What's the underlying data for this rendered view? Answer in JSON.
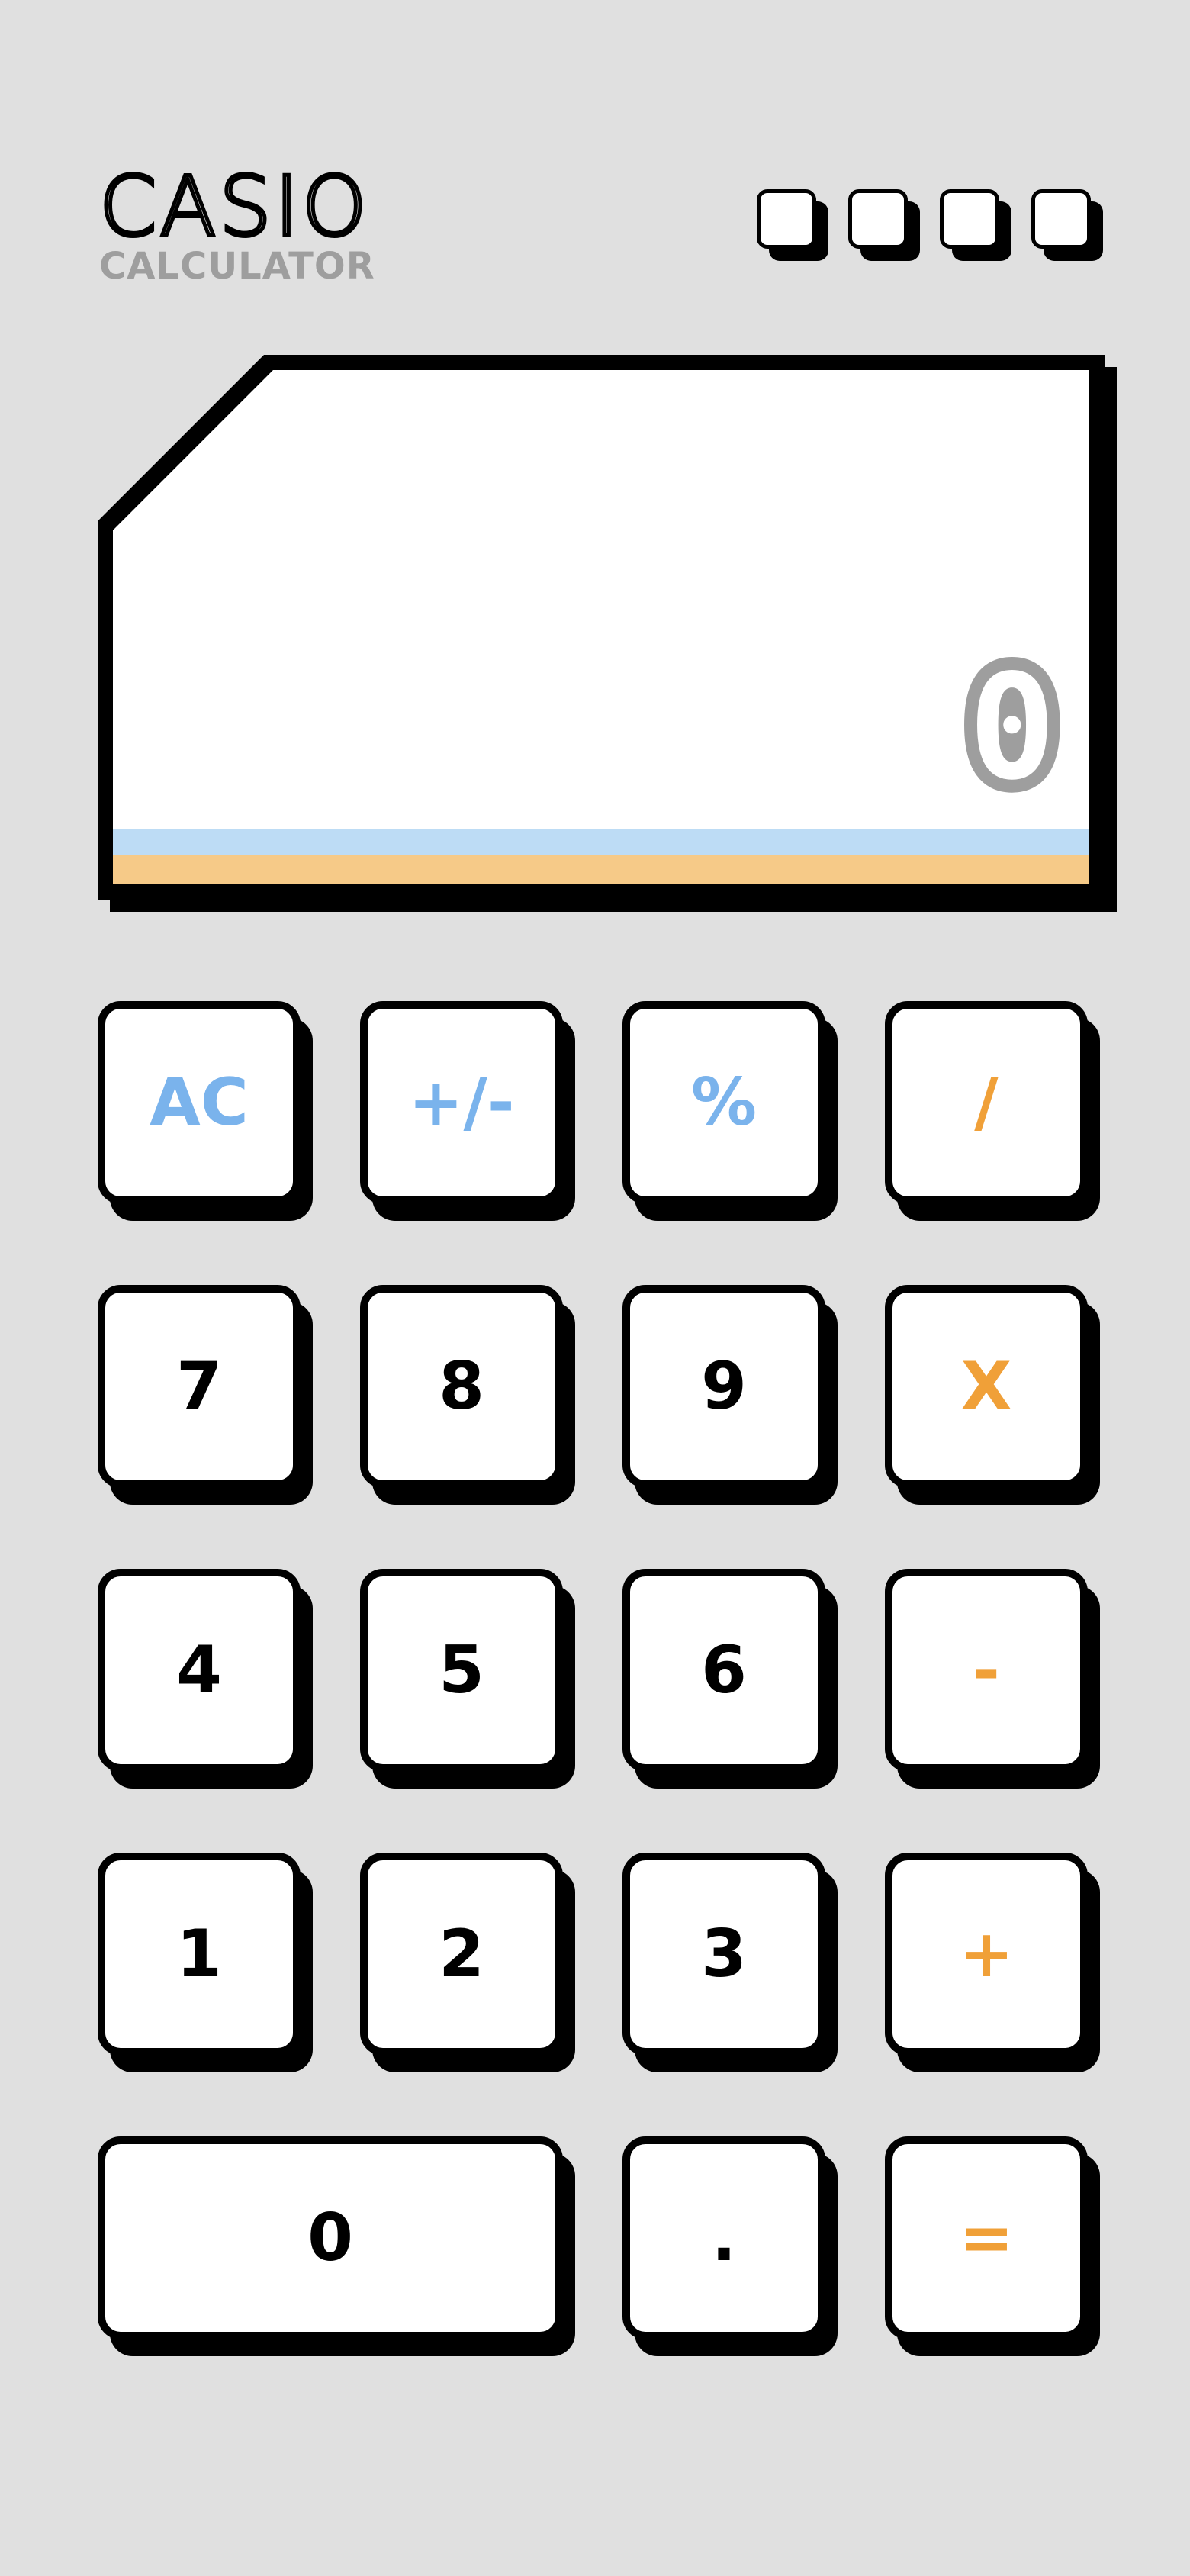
{
  "header": {
    "brand": "CASIO",
    "subtitle": "CALCULATOR"
  },
  "display": {
    "value": "0"
  },
  "colors": {
    "background": "#e0e0e0",
    "function_key_text": "#7ab3ec",
    "operator_key_text": "#f0a038",
    "display_text": "#9e9e9e",
    "stripe_blue": "#bddcf5",
    "stripe_orange": "#f6ca88"
  },
  "solar_panel": {
    "cell_count": 4,
    "icon": "solar-cell-icon"
  },
  "keys": {
    "ac": "AC",
    "sign": "+/-",
    "percent": "%",
    "divide": "/",
    "seven": "7",
    "eight": "8",
    "nine": "9",
    "multiply": "X",
    "four": "4",
    "five": "5",
    "six": "6",
    "subtract": "-",
    "one": "1",
    "two": "2",
    "three": "3",
    "add": "+",
    "zero": "0",
    "decimal": ".",
    "equals": "="
  }
}
